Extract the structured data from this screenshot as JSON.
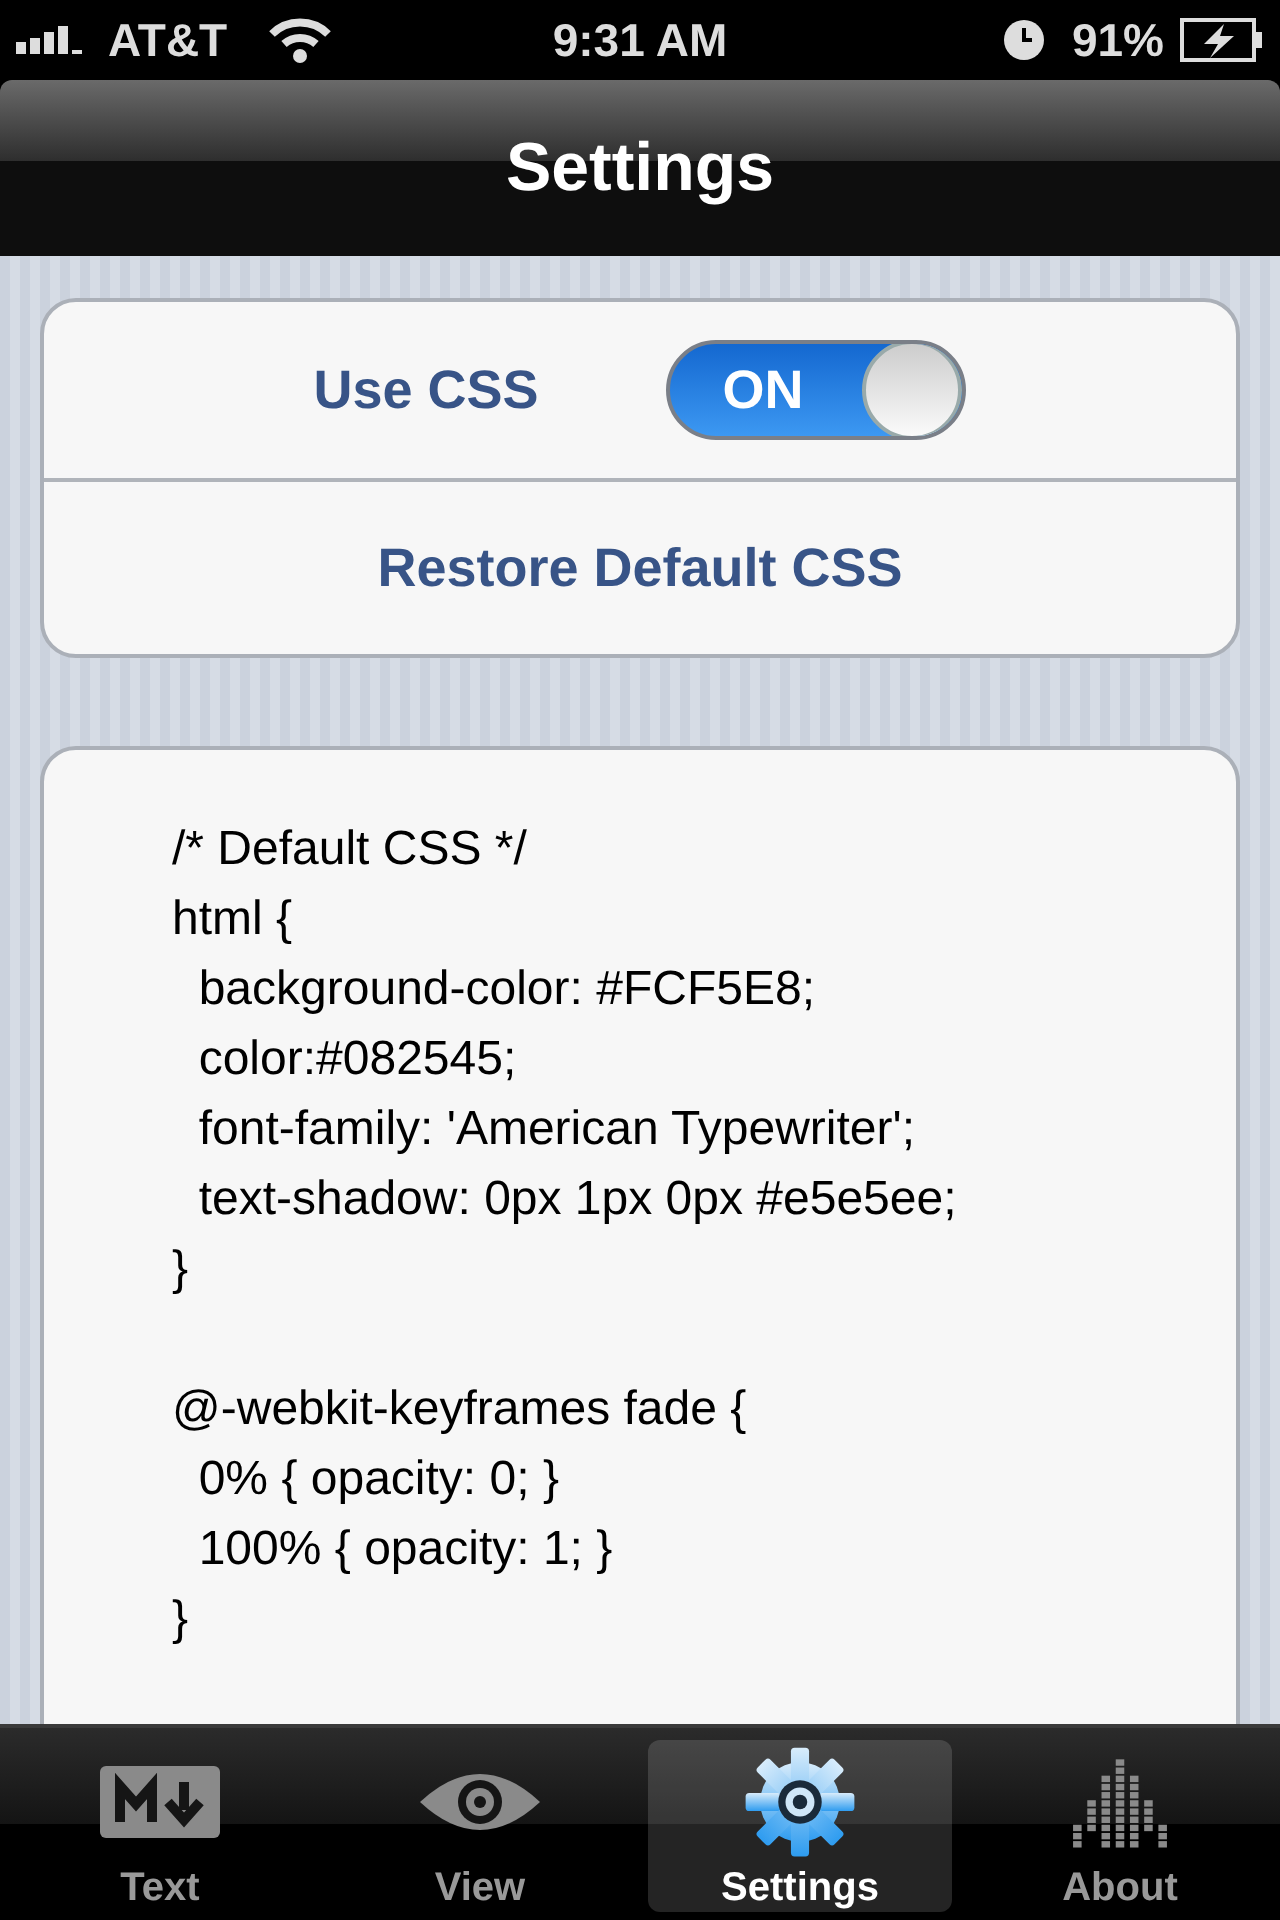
{
  "status_bar": {
    "carrier": "AT&T",
    "time": "9:31 AM",
    "battery": "91%"
  },
  "nav_bar": {
    "title": "Settings"
  },
  "settings": [
    {
      "kind": "toggle",
      "label": "Use CSS",
      "on": true,
      "switch_label": "ON"
    },
    {
      "kind": "action",
      "label": "Restore Default CSS"
    }
  ],
  "css_editor": {
    "blocks": [
      {
        "lines": [
          "/* Default CSS */",
          "html {",
          "  background-color: #FCF5E8;",
          "  color:#082545;",
          "  font-family: 'American Typewriter';",
          "  text-shadow: 0px 1px 0px #e5e5ee;",
          "}"
        ]
      },
      {
        "lines": [
          "@-webkit-keyframes fade {",
          "  0% { opacity: 0; }",
          "  100% { opacity: 1; }",
          "}"
        ]
      }
    ]
  },
  "tab_bar": [
    {
      "kind": "text",
      "label": "Text",
      "selected": false
    },
    {
      "kind": "view",
      "label": "View",
      "selected": false
    },
    {
      "kind": "settings",
      "label": "Settings",
      "selected": true
    },
    {
      "kind": "about",
      "label": "About",
      "selected": false
    }
  ]
}
